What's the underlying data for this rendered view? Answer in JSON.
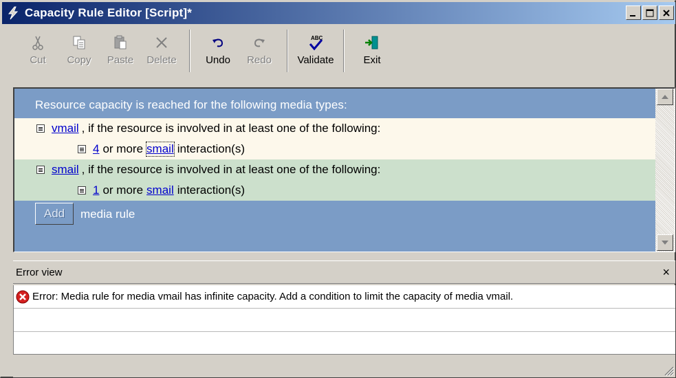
{
  "window": {
    "title": "Capacity Rule Editor [Script]*"
  },
  "toolbar": {
    "buttons": [
      {
        "label": "Cut",
        "icon": "scissors-icon",
        "enabled": false
      },
      {
        "label": "Copy",
        "icon": "copy-icon",
        "enabled": false
      },
      {
        "label": "Paste",
        "icon": "paste-icon",
        "enabled": false
      },
      {
        "label": "Delete",
        "icon": "delete-x-icon",
        "enabled": false
      },
      {
        "label": "Undo",
        "icon": "undo-icon",
        "enabled": true
      },
      {
        "label": "Redo",
        "icon": "redo-icon",
        "enabled": false
      },
      {
        "label": "Validate",
        "icon": "spellcheck-icon",
        "enabled": true
      },
      {
        "label": "Exit",
        "icon": "exit-door-icon",
        "enabled": true
      }
    ]
  },
  "editor": {
    "header": "Resource capacity is reached for the following media types:",
    "rules": [
      {
        "media": "vmail",
        "condition_text": ", if the resource is involved in at least one of the following:",
        "count": "4",
        "or_more": "or more",
        "target_media": "smail",
        "suffix": "interaction(s)"
      },
      {
        "media": "smail",
        "condition_text": ", if the resource is involved in at least one of the following:",
        "count": "1",
        "or_more": "or more",
        "target_media": "smail",
        "suffix": "interaction(s)"
      }
    ],
    "add_button": "Add",
    "add_label": "media rule"
  },
  "error_view": {
    "title": "Error view",
    "close": "×",
    "errors": [
      "Error: Media rule for media vmail has infinite capacity. Add a condition to limit the capacity of media vmail."
    ]
  },
  "colors": {
    "editor_bg": "#7b9cc6",
    "vmail_row": "#fdf8eb",
    "smail_row": "#cce0cc",
    "link": "#0000cc",
    "error_red": "#d42020"
  }
}
